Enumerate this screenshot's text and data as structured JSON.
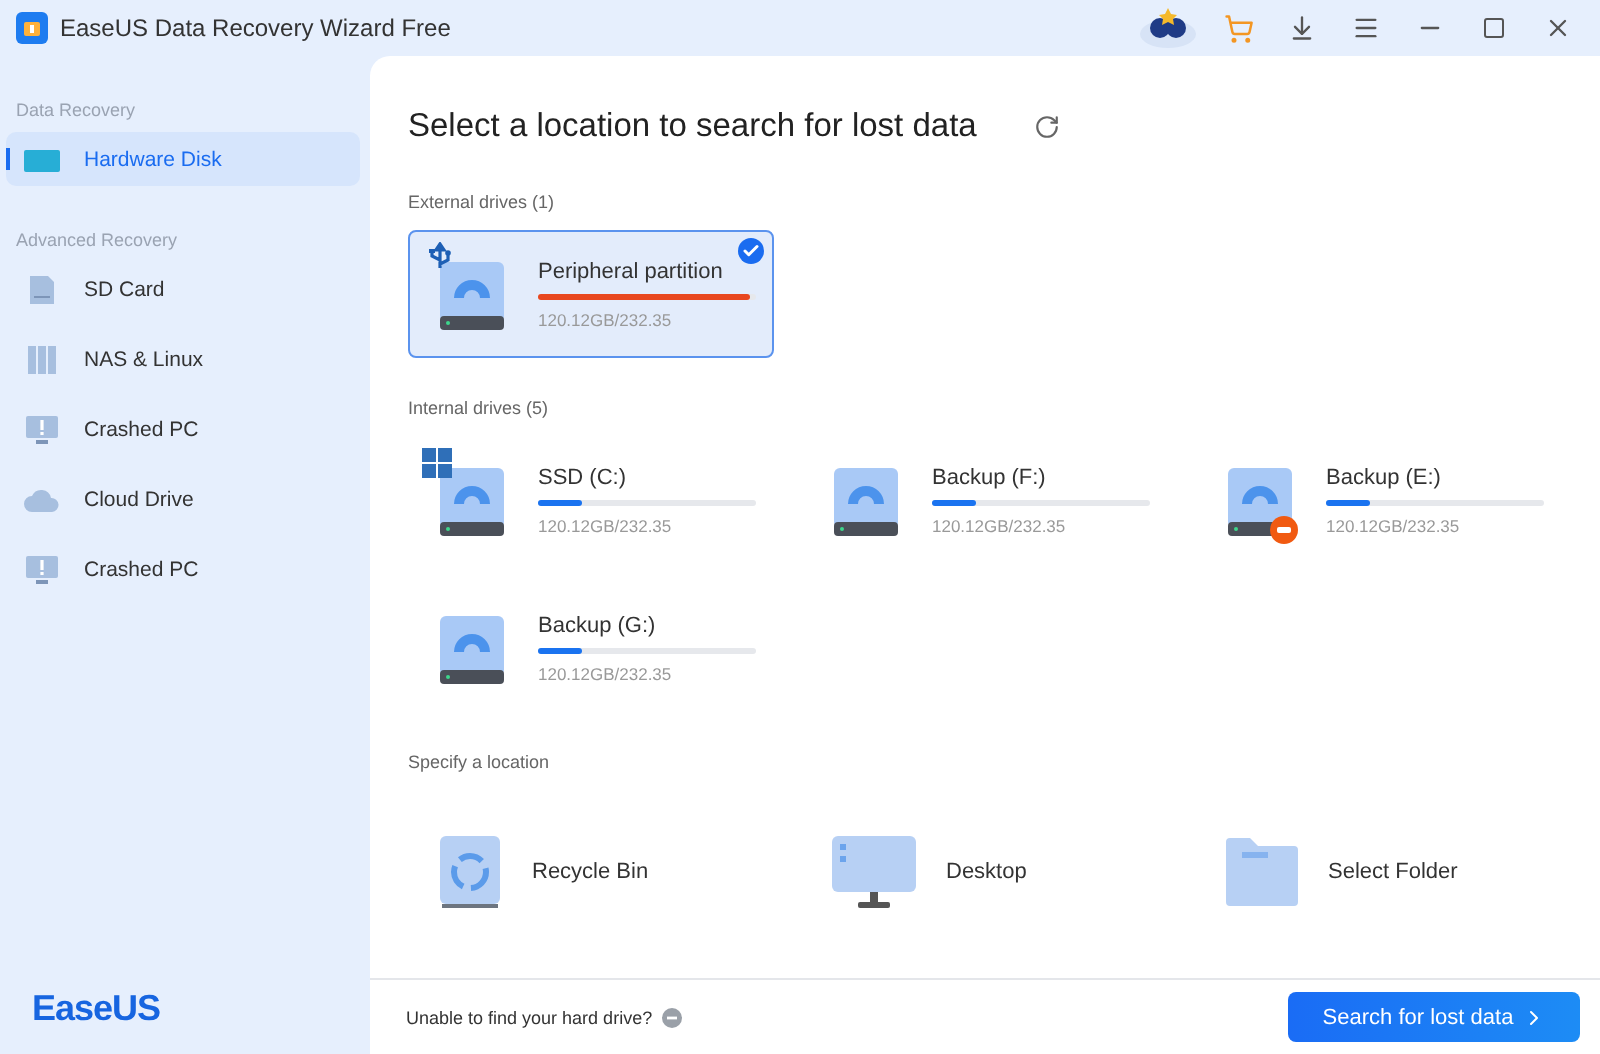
{
  "window": {
    "title": "EaseUS Data Recovery Wizard Free"
  },
  "sidebar": {
    "sections": [
      {
        "label": "Data Recovery",
        "items": [
          {
            "label": "Hardware Disk",
            "kind": "disk",
            "selected": true
          }
        ]
      },
      {
        "label": "Advanced Recovery",
        "items": [
          {
            "label": "SD Card",
            "kind": "sdcard",
            "selected": false
          },
          {
            "label": "NAS & Linux",
            "kind": "nas",
            "selected": false
          },
          {
            "label": "Crashed PC",
            "kind": "crashed",
            "selected": false
          },
          {
            "label": "Cloud Drive",
            "kind": "cloud",
            "selected": false
          },
          {
            "label": "Crashed PC",
            "kind": "crashed",
            "selected": false
          }
        ]
      }
    ],
    "logo": "EaseUS"
  },
  "main": {
    "heading": "Select a location to search for lost data",
    "drive_groups": [
      {
        "label": "External drives (1)",
        "drives": [
          {
            "name": "Peripheral partition",
            "kind": "usb",
            "selected": true,
            "level": 0.97,
            "color": "#e8471f",
            "size": "120.12GB/232.35"
          }
        ]
      },
      {
        "label": "Internal drives (5)",
        "drives": [
          {
            "name": "SSD (C:)",
            "kind": "windows",
            "selected": false,
            "level": 0.2,
            "color": "#1a73f0",
            "size": "120.12GB/232.35"
          },
          {
            "name": "Backup (F:)",
            "kind": "plain",
            "selected": false,
            "level": 0.2,
            "color": "#1a73f0",
            "size": "120.12GB/232.35"
          },
          {
            "name": "Backup (E:)",
            "kind": "error",
            "selected": false,
            "level": 0.2,
            "color": "#1a73f0",
            "size": "120.12GB/232.35"
          },
          {
            "name": "Backup (G:)",
            "kind": "plain",
            "selected": false,
            "level": 0.2,
            "color": "#1a73f0",
            "size": "120.12GB/232.35"
          }
        ]
      }
    ],
    "locations_label": "Specify a location",
    "locations": [
      {
        "label": "Recycle Bin",
        "kind": "recycle"
      },
      {
        "label": "Desktop",
        "kind": "desktop"
      },
      {
        "label": "Select Folder",
        "kind": "folder"
      }
    ]
  },
  "footer": {
    "help": "Unable to find your hard drive?",
    "button": "Search for lost data"
  }
}
